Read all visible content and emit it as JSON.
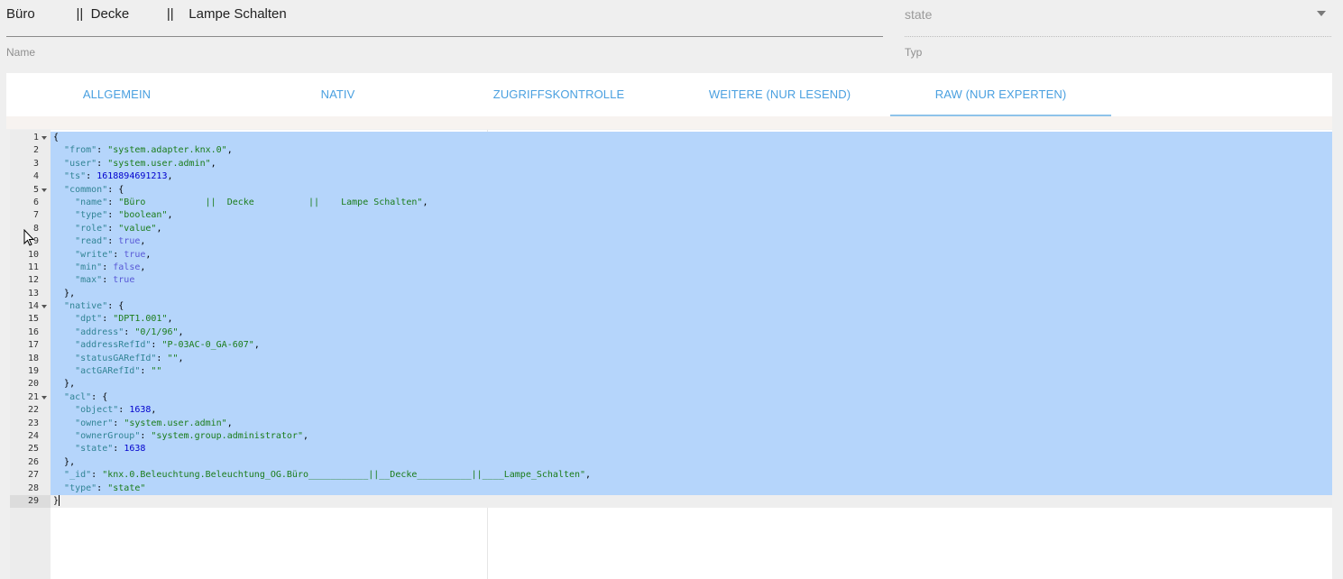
{
  "object": {
    "name_value": "Büro           ||  Decke          ||    Lampe Schalten",
    "name_label": "Name",
    "type_value": "state",
    "type_label": "Typ"
  },
  "tabs": [
    {
      "label": "ALLGEMEIN",
      "active": false
    },
    {
      "label": "NATIV",
      "active": false
    },
    {
      "label": "ZUGRIFFSKONTROLLE",
      "active": false
    },
    {
      "label": "WEITERE (NUR LESEND)",
      "active": false
    },
    {
      "label": "RAW (NUR EXPERTEN)",
      "active": true
    }
  ],
  "editor": {
    "lines": [
      {
        "n": "1",
        "fold": true,
        "t": "{"
      },
      {
        "n": "2",
        "t": "  \"from\": \"system.adapter.knx.0\","
      },
      {
        "n": "3",
        "t": "  \"user\": \"system.user.admin\","
      },
      {
        "n": "4",
        "t": "  \"ts\": 1618894691213,"
      },
      {
        "n": "5",
        "fold": true,
        "t": "  \"common\": {"
      },
      {
        "n": "6",
        "t": "    \"name\": \"Büro           ||  Decke          ||    Lampe Schalten\","
      },
      {
        "n": "7",
        "t": "    \"type\": \"boolean\","
      },
      {
        "n": "8",
        "t": "    \"role\": \"value\","
      },
      {
        "n": "9",
        "t": "    \"read\": true,"
      },
      {
        "n": "10",
        "t": "    \"write\": true,"
      },
      {
        "n": "11",
        "t": "    \"min\": false,"
      },
      {
        "n": "12",
        "t": "    \"max\": true"
      },
      {
        "n": "13",
        "t": "  },"
      },
      {
        "n": "14",
        "fold": true,
        "t": "  \"native\": {"
      },
      {
        "n": "15",
        "t": "    \"dpt\": \"DPT1.001\","
      },
      {
        "n": "16",
        "t": "    \"address\": \"0/1/96\","
      },
      {
        "n": "17",
        "t": "    \"addressRefId\": \"P-03AC-0_GA-607\","
      },
      {
        "n": "18",
        "t": "    \"statusGARefId\": \"\","
      },
      {
        "n": "19",
        "t": "    \"actGARefId\": \"\""
      },
      {
        "n": "20",
        "t": "  },"
      },
      {
        "n": "21",
        "fold": true,
        "t": "  \"acl\": {"
      },
      {
        "n": "22",
        "t": "    \"object\": 1638,"
      },
      {
        "n": "23",
        "t": "    \"owner\": \"system.user.admin\","
      },
      {
        "n": "24",
        "t": "    \"ownerGroup\": \"system.group.administrator\","
      },
      {
        "n": "25",
        "t": "    \"state\": 1638"
      },
      {
        "n": "26",
        "t": "  },"
      },
      {
        "n": "27",
        "t": "  \"_id\": \"knx.0.Beleuchtung.Beleuchtung_OG.Büro___________||__Decke__________||____Lampe_Schalten\","
      },
      {
        "n": "28",
        "t": "  \"type\": \"state\""
      },
      {
        "n": "29",
        "t": "}"
      }
    ]
  },
  "colors": {
    "tab_text": "#4aa0e0",
    "selection": "#b5d5fb",
    "json_key": "#318495",
    "json_string": "#1a7c1a",
    "json_number": "#0000cd",
    "json_boolean": "#5858d6"
  }
}
